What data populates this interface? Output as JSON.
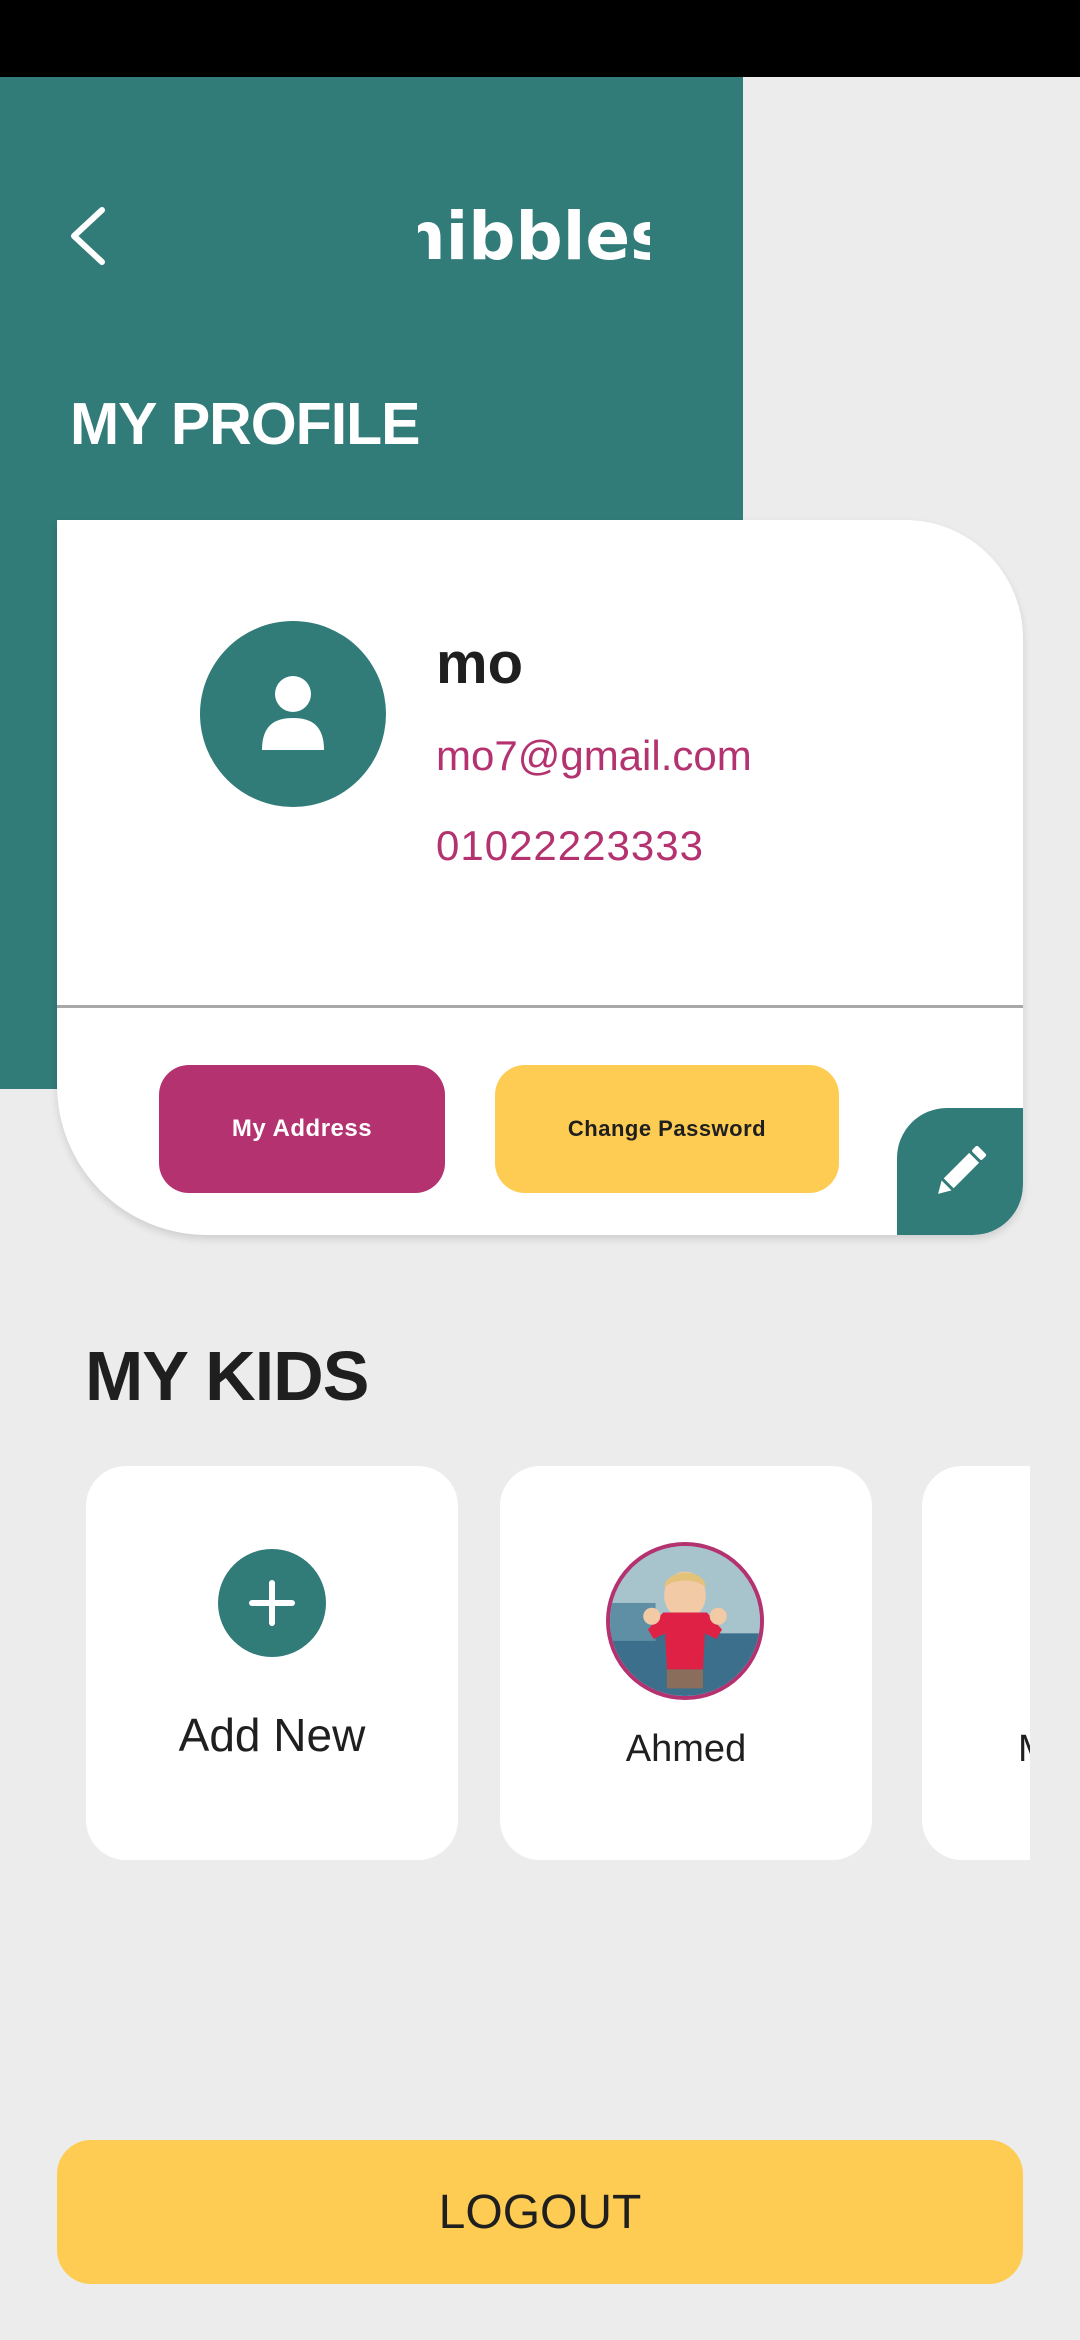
{
  "header": {
    "back_icon": "chevron-left-icon",
    "logo_text": "nibbles"
  },
  "profile": {
    "heading": "MY PROFILE",
    "avatar_icon": "user-icon",
    "name": "mo",
    "email": "mo7@gmail.com",
    "phone": "01022223333",
    "address_button": "My Address",
    "password_button": "Change Password",
    "edit_icon": "pencil-icon"
  },
  "kids": {
    "heading": "MY KIDS",
    "add_new_label": "Add New",
    "add_icon": "plus-icon",
    "items": [
      {
        "name": "Ahmed"
      },
      {
        "name": "M"
      }
    ]
  },
  "logout": {
    "label": "LOGOUT"
  },
  "colors": {
    "teal": "#317b78",
    "magenta": "#b3326f",
    "yellow": "#fecc52",
    "background": "#ececec"
  }
}
